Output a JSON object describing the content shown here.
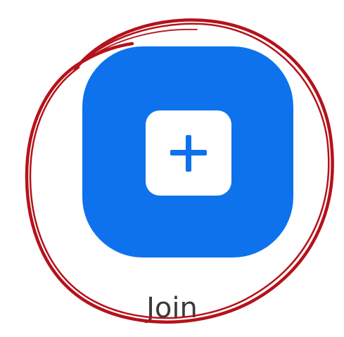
{
  "join": {
    "label": "Join",
    "icon": "plus-icon",
    "background_color": "#0e72ed",
    "tile_color": "#ffffff"
  },
  "annotation": {
    "shape": "hand-drawn circle",
    "color": "#b5121b"
  }
}
